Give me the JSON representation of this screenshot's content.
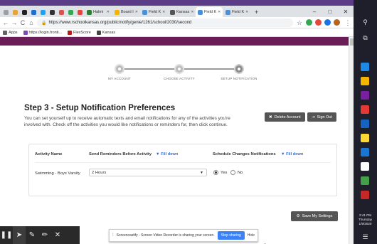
{
  "colors": {
    "desktop": "#5a3d86",
    "tabbar": "#dee1e6",
    "page_header": "#6b1d57",
    "link_blue": "#2d6cdf",
    "taskbar": "#1f1f2b",
    "button_dark": "#555555"
  },
  "browser": {
    "pinned_tabs": [
      {
        "name": "chrome-icon",
        "color": "#9aa0a6"
      },
      {
        "name": "wallet-icon",
        "color": "#e8a33b"
      },
      {
        "name": "news-icon",
        "color": "#222222"
      },
      {
        "name": "f-icon",
        "color": "#1f6fd0"
      },
      {
        "name": "twitter-icon",
        "color": "#1da1f2"
      },
      {
        "name": "bb-icon",
        "color": "#333333"
      },
      {
        "name": "clipboard-icon",
        "color": "#d9534f"
      },
      {
        "name": "drive-icon",
        "color": "#34a853"
      },
      {
        "name": "gmail-icon",
        "color": "#ea4335"
      }
    ],
    "tabs": [
      {
        "title": "Halmi",
        "color": "#2e7d32",
        "active": false
      },
      {
        "title": "Board I",
        "color": "#f4b400",
        "active": false
      },
      {
        "title": "Field K",
        "color": "#4a90d9",
        "active": false
      },
      {
        "title": "Kansas",
        "color": "#555555",
        "active": false
      },
      {
        "title": "Field K",
        "color": "#4a90d9",
        "active": true
      },
      {
        "title": "Field K",
        "color": "#4a90d9",
        "active": false
      }
    ],
    "new_tab": "+",
    "window_controls": {
      "minimize": "–",
      "maximize": "□",
      "close": "✕"
    },
    "nav": {
      "back": "←",
      "forward": "→",
      "reload": "C",
      "home": "⌂"
    },
    "url": "https://www.rschoolkansas.org/public/notify/genie/1261/school/2030/second",
    "star": "☆",
    "extensions": [
      {
        "name": "extension-green-icon",
        "color": "#34a853"
      },
      {
        "name": "extension-red-icon",
        "color": "#e8453c"
      },
      {
        "name": "extension-blue-icon",
        "color": "#1a73e8"
      },
      {
        "name": "profile-avatar-icon",
        "color": "#b5651d"
      }
    ],
    "menu": "⋮",
    "bookmarks": [
      {
        "label": "Apps",
        "color": "#5f6368"
      },
      {
        "label": "https://login.fronti...",
        "color": "#7b4bb8"
      },
      {
        "label": "FlexScore",
        "color": "#b71c1c"
      },
      {
        "label": "Kansas",
        "color": "#444444"
      }
    ]
  },
  "steps": [
    {
      "label": "MY ACCOUNT",
      "active": false
    },
    {
      "label": "CHOOSE ACTIVITY",
      "active": false
    },
    {
      "label": "SETUP NOTIFICATION",
      "active": true
    }
  ],
  "main": {
    "heading": "Step 3 - Setup Notification Preferences",
    "description": "You can set yourself up to receive automatic texts and email notifications for any of the activities you're involved with. Check off the activities you would like notifications or reminders for, then click continue.",
    "delete_button": "Delete Account",
    "delete_icon": "✖",
    "signout_button": "Sign Out",
    "signout_icon": "⇥",
    "table": {
      "headers": {
        "activity": "Activity Name",
        "reminders": "Send Reminders Before Activity",
        "fill_down_1": "▼ Fill down",
        "schedule": "Schedule Changes Notifications",
        "fill_down_2": "▼ Fill down"
      },
      "row": {
        "activity": "Swimming - Boys Varsity",
        "reminder_value": "2 Hours",
        "radio_yes": "Yes",
        "radio_no": "No",
        "selected": "Yes"
      }
    },
    "save_button": "Save My Settings",
    "save_icon": "⚙"
  },
  "taskbar": {
    "glyphs": [
      {
        "name": "search-icon",
        "glyph": "⚲"
      },
      {
        "name": "task-view-icon",
        "glyph": "⧉"
      }
    ],
    "apps": [
      {
        "name": "store-app-icon",
        "color": "#1e88e5"
      },
      {
        "name": "explorer-app-icon",
        "color": "#f4b400"
      },
      {
        "name": "screen-app-icon",
        "color": "#7b1fa2"
      },
      {
        "name": "chrome-app-icon",
        "color": "#e53935"
      },
      {
        "name": "word-app-icon",
        "color": "#1565c0"
      },
      {
        "name": "sticky-app-icon",
        "color": "#fdd835"
      },
      {
        "name": "edge-app-icon",
        "color": "#1976d2"
      },
      {
        "name": "clock-app-icon",
        "color": "#ffffff"
      },
      {
        "name": "photos-app-icon",
        "color": "#43a047"
      },
      {
        "name": "acrobat-app-icon",
        "color": "#c62828"
      }
    ],
    "tray_chevron": "<",
    "time": "2:41 PM",
    "day": "Thursday",
    "date": "1/9/2020",
    "notifications_icon": "☰"
  },
  "overlay": {
    "tools": [
      {
        "name": "pause-icon",
        "glyph": "❚❚"
      },
      {
        "name": "pointer-icon",
        "glyph": "➤"
      },
      {
        "name": "pen-icon",
        "glyph": "✎"
      },
      {
        "name": "highlighter-icon",
        "glyph": "✏"
      },
      {
        "name": "close-toolbar-icon",
        "glyph": "✕"
      }
    ],
    "message": "Screencastify - Screen Video Recorder is sharing your screen.",
    "stop_label": "Stop sharing",
    "hide_label": "Hide"
  }
}
